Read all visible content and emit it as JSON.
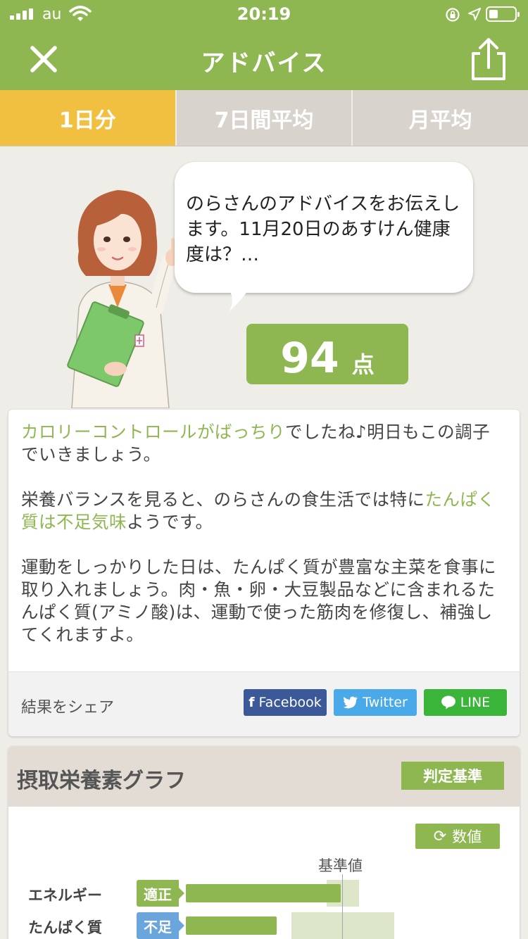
{
  "status_bar": {
    "carrier": "au",
    "time": "20:19"
  },
  "nav": {
    "title": "アドバイス"
  },
  "tabs": [
    {
      "label": "1日分",
      "active": true
    },
    {
      "label": "7日間平均",
      "active": false
    },
    {
      "label": "月平均",
      "active": false
    }
  ],
  "bubble": {
    "text": "のらさんのアドバイスをお伝えします。11月20日のあすけん健康度は？…"
  },
  "score": {
    "value": "94",
    "unit": "点"
  },
  "advice": {
    "p1_highlight": "カロリーコントロールがばっちり",
    "p1_rest": "でしたね♪明日もこの調子でいきましょう。",
    "p2_pre": "栄養バランスを見ると、のらさんの食生活では特に",
    "p2_highlight": "たんぱく質は不足気味",
    "p2_post": "ようです。",
    "p3": "運動をしっかりした日は、たんぱく質が豊富な主菜を食事に取り入れましょう。肉・魚・卵・大豆製品などに含まれるたんぱく質(アミノ酸)は、運動で使った筋肉を修復し、補強してくれますよ。"
  },
  "share": {
    "label": "結果をシェア",
    "facebook": "Facebook",
    "twitter": "Twitter",
    "line": "LINE"
  },
  "graph": {
    "title": "摂取栄養素グラフ",
    "criteria_button": "判定基準",
    "values_button": "数値",
    "reference_label": "基準値",
    "nutrients": [
      {
        "name": "エネルギー",
        "status": "適正",
        "status_color": "#8fb751",
        "fraction_of_reference": 0.99
      },
      {
        "name": "たんぱく質",
        "status": "不足",
        "status_color": "#6aa5db",
        "fraction_of_reference": 0.58
      }
    ]
  },
  "colors": {
    "brand": "#8fb751",
    "tab_active": "#f1c040",
    "tab_inactive": "#d8d3cc",
    "facebook": "#3b5998",
    "twitter": "#4aa9e9",
    "line": "#3ab53a"
  }
}
